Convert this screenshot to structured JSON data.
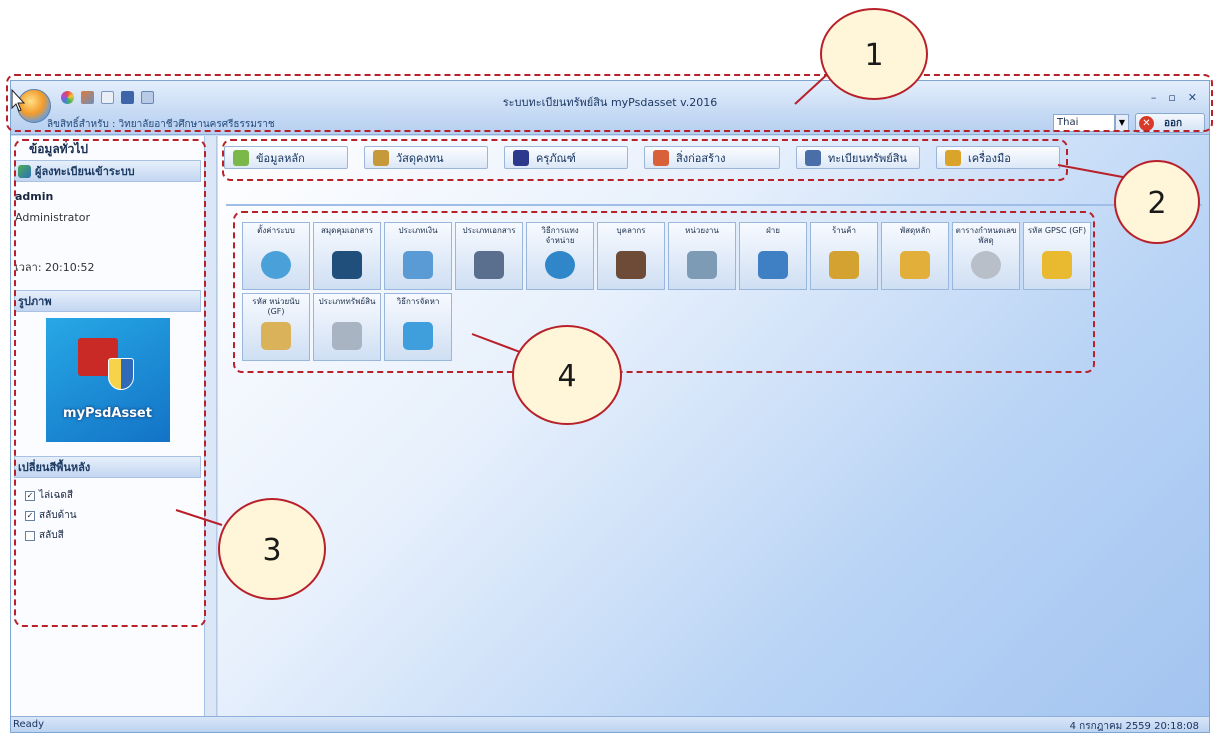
{
  "window": {
    "title": "ระบบทะเบียนทรัพย์สิน  myPsdasset v.2016",
    "license": "ลิขสิทธิ์สำหรับ :  วิทยาลัยอาชีวศึกษานครศรีธรรมราช",
    "controls": [
      "–",
      "▫",
      "✕"
    ]
  },
  "language": {
    "selected": "Thai"
  },
  "logout_label": "ออก",
  "left_panel": {
    "header": "ข้อมูลทั่วไป",
    "user_section": "ผู้ลงทะเบียนเข้าระบบ",
    "user_name": "admin",
    "user_role": "Administrator",
    "time_label": "เวลา: 20:10:52",
    "image_section": "รูปภาพ",
    "logo_text": "myPsdAsset",
    "bg_section": "เปลี่ยนสีพื้นหลัง",
    "bg_options": [
      {
        "label": "ไล่เฉดสี",
        "checked": true
      },
      {
        "label": "สลับด้าน",
        "checked": true
      },
      {
        "label": "สลับสี",
        "checked": false
      }
    ]
  },
  "toolbar": [
    {
      "label": "ข้อมูลหลัก",
      "icon": "table-icon",
      "color": "#7bb84a"
    },
    {
      "label": "วัสดุคงทน",
      "icon": "tools-icon",
      "color": "#c69a3a"
    },
    {
      "label": "ครุภัณฑ์",
      "icon": "car-icon",
      "color": "#2d3a8c"
    },
    {
      "label": "สิ่งก่อสร้าง",
      "icon": "building-icon",
      "color": "#d8613a"
    },
    {
      "label": "ทะเบียนทรัพย์สิน",
      "icon": "ledger-icon",
      "color": "#4a6ea8"
    },
    {
      "label": "เครื่องมือ",
      "icon": "wrench-icon",
      "color": "#d9a429"
    }
  ],
  "tiles": [
    {
      "label": "ตั้งค่าระบบ",
      "icon": "key-icon",
      "color": "#4aa0d8"
    },
    {
      "label": "สมุดคุมเอกสาร",
      "icon": "book-icon",
      "color": "#1f4f7a"
    },
    {
      "label": "ประเภทเงิน",
      "icon": "money-icon",
      "color": "#5b9bd5"
    },
    {
      "label": "ประเภทเอกสาร",
      "icon": "document-icon",
      "color": "#5a6f8e"
    },
    {
      "label": "วิธีการแทงจำหน่าย",
      "icon": "disposal-icon",
      "color": "#2f86c9"
    },
    {
      "label": "บุคลากร",
      "icon": "people-icon",
      "color": "#6d4b36"
    },
    {
      "label": "หน่วยงาน",
      "icon": "org-chart-icon",
      "color": "#7d9bb5"
    },
    {
      "label": "ฝ่าย",
      "icon": "group-icon",
      "color": "#3f7fc4"
    },
    {
      "label": "ร้านค้า",
      "icon": "shop-door-icon",
      "color": "#d3a231"
    },
    {
      "label": "พัสดุหลัก",
      "icon": "cart-icon",
      "color": "#e2b03a"
    },
    {
      "label": "ตารางกำหนดเลขพัสดุ",
      "icon": "gear-icon",
      "color": "#b8bfc8"
    },
    {
      "label": "รหัส GPSC (GF)",
      "icon": "percent-tag-icon",
      "color": "#e9b92f"
    },
    {
      "label": "รหัส หน่วยนับ (GF)",
      "icon": "paperclip-icon",
      "color": "#d9b25a"
    },
    {
      "label": "ประเภททรัพย์สิน",
      "icon": "percent-icon",
      "color": "#a9b4c2"
    },
    {
      "label": "วิธีการจัดหา",
      "icon": "handshake-icon",
      "color": "#3e9fdc"
    }
  ],
  "status": {
    "left": "Ready",
    "right": "4 กรกฎาคม 2559 20:18:08"
  },
  "annotations": [
    "1",
    "2",
    "3",
    "4"
  ]
}
